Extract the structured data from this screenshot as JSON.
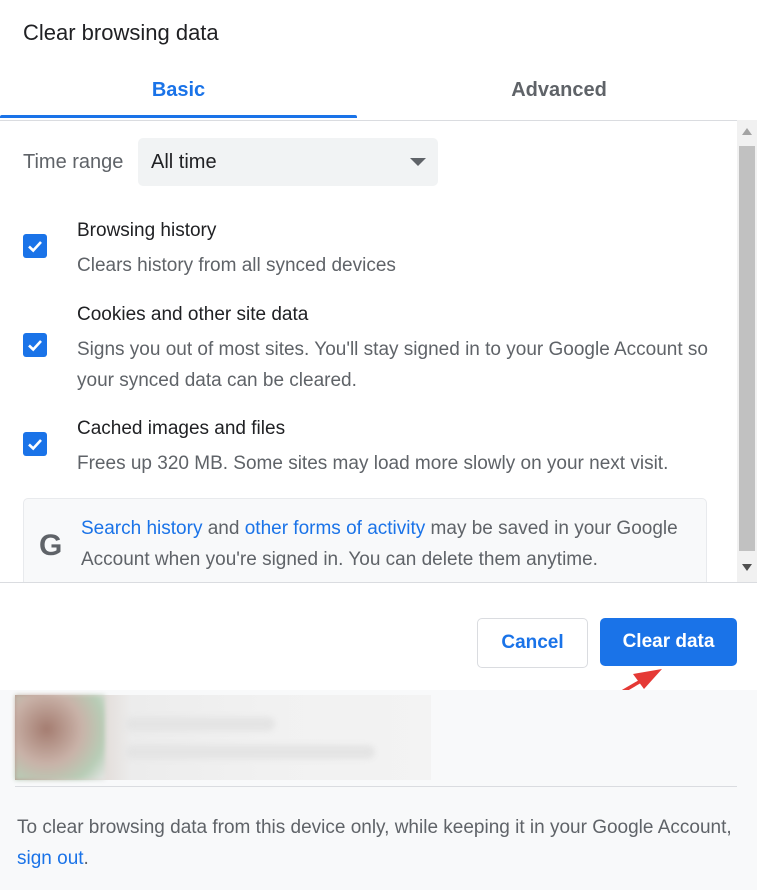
{
  "dialog": {
    "title": "Clear browsing data"
  },
  "tabs": [
    {
      "label": "Basic",
      "selected": true
    },
    {
      "label": "Advanced",
      "selected": false
    }
  ],
  "time_range": {
    "label": "Time range",
    "value": "All time"
  },
  "items": [
    {
      "title": "Browsing history",
      "description": "Clears history from all synced devices",
      "checked": true
    },
    {
      "title": "Cookies and other site data",
      "description": "Signs you out of most sites. You'll stay signed in to your Google Account so your synced data can be cleared.",
      "checked": true
    },
    {
      "title": "Cached images and files",
      "description": "Frees up 320 MB. Some sites may load more slowly on your next visit.",
      "checked": true
    }
  ],
  "info": {
    "icon": "google-g-icon",
    "link1": "Search history",
    "text1": " and ",
    "link2": "other forms of activity",
    "text2": " may be saved in your Google Account when you're signed in. You can delete them anytime."
  },
  "buttons": {
    "cancel": "Cancel",
    "clear": "Clear data"
  },
  "footer": {
    "text": "To clear browsing data from this device only, while keeping it in your Google Account, ",
    "link": "sign out",
    "suffix": "."
  },
  "colors": {
    "accent": "#1a73e8",
    "annotation_arrow": "#e53935"
  }
}
